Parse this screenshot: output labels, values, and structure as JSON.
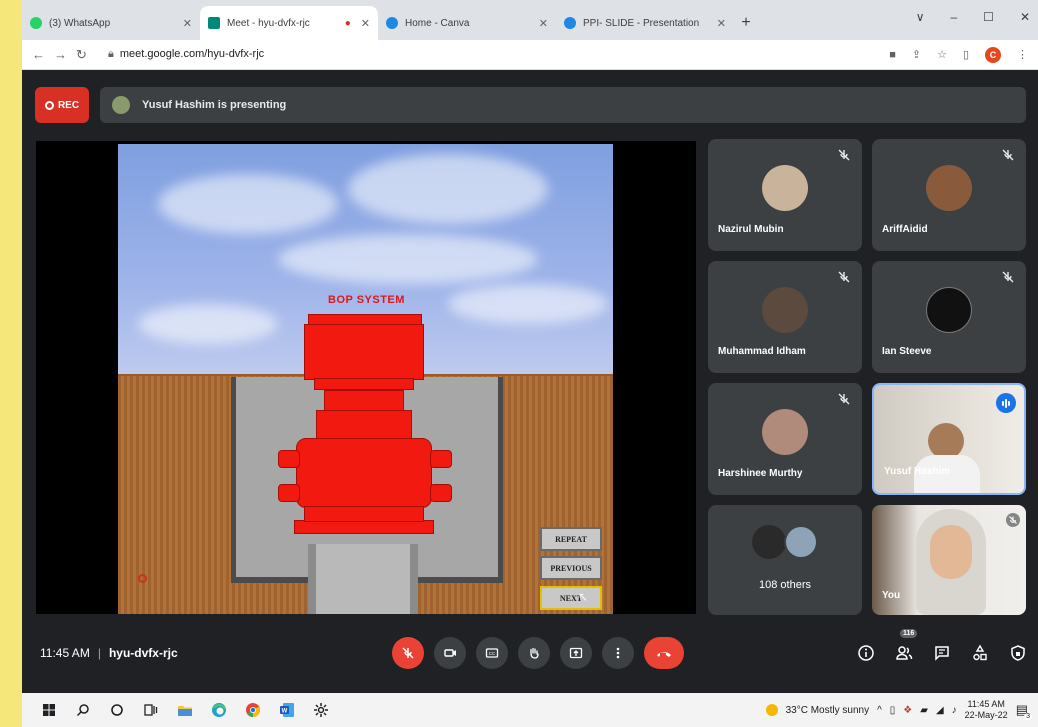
{
  "browser": {
    "tabs": [
      {
        "title": "(3) WhatsApp",
        "favicon_color": "#25d366"
      },
      {
        "title": "Meet - hyu-dvfx-rjc",
        "favicon_color": "#00897b",
        "active": true
      },
      {
        "title": "Home - Canva",
        "favicon_color": "#1e88e5"
      },
      {
        "title": "PPI- SLIDE - Presentation",
        "favicon_color": "#1e88e5"
      }
    ],
    "new_tab": "+",
    "window_controls": [
      "∨",
      "–",
      "☐",
      "✕"
    ],
    "url": "meet.google.com/hyu-dvfx-rjc",
    "profile_initial": "C"
  },
  "meet": {
    "rec_label": "REC",
    "presenting_text": "Yusuf Hashim is presenting",
    "slide": {
      "title": "BOP SYSTEM",
      "buttons": [
        "REPEAT",
        "PREVIOUS",
        "NEXT"
      ]
    },
    "participants": [
      {
        "name": "Nazirul Mubin",
        "avatar_color": "#c9b39a",
        "muted": true
      },
      {
        "name": "AriffAidid",
        "avatar_color": "#8a5a3c",
        "muted": true
      },
      {
        "name": "Muhammad Idham",
        "avatar_color": "#5c4a3e",
        "muted": true
      },
      {
        "name": "Ian Steeve",
        "avatar_color": "#111111",
        "muted": true
      },
      {
        "name": "Harshinee Murthy",
        "avatar_color": "#b08a7a",
        "muted": true
      },
      {
        "name": "Yusuf Hashim",
        "avatar_color": "#d4cfc6",
        "muted": false,
        "speaking": true
      }
    ],
    "others": {
      "label": "108 others"
    },
    "self_tile": {
      "name": "You"
    },
    "time": "11:45 AM",
    "meeting_code": "hyu-dvfx-rjc",
    "people_count": "116",
    "accent": "#1a73e8",
    "danger": "#ea4335"
  },
  "taskbar": {
    "weather": "33°C  Mostly sunny",
    "time": "11:45 AM",
    "date": "22-May-22",
    "notif_count": "3"
  }
}
